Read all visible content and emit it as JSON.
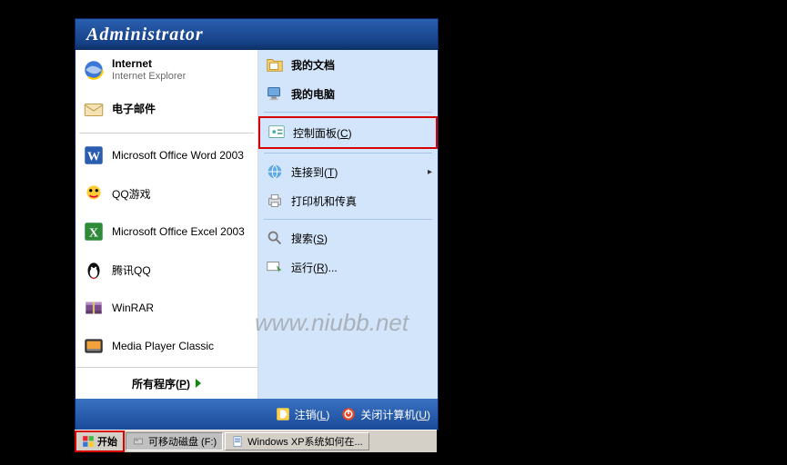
{
  "header": {
    "username": "Administrator"
  },
  "left": {
    "internet": {
      "title": "Internet",
      "subtitle": "Internet Explorer"
    },
    "email": {
      "title": "电子邮件"
    },
    "pinned": [
      {
        "id": "word",
        "label": "Microsoft Office Word 2003"
      },
      {
        "id": "qqgame",
        "label": "QQ游戏"
      },
      {
        "id": "excel",
        "label": "Microsoft Office Excel 2003"
      },
      {
        "id": "qq",
        "label": "腾讯QQ"
      },
      {
        "id": "winrar",
        "label": "WinRAR"
      },
      {
        "id": "mpc",
        "label": "Media Player Classic"
      }
    ],
    "all_programs": {
      "label": "所有程序(",
      "key": "P",
      "suffix": ")"
    }
  },
  "right": {
    "items": [
      {
        "id": "mydocs",
        "label": "我的文档",
        "bold": true
      },
      {
        "id": "mycomp",
        "label": "我的电脑",
        "bold": true
      },
      {
        "sep": true
      },
      {
        "id": "control",
        "label": "控制面板(",
        "key": "C",
        "suffix": ")",
        "highlight": true
      },
      {
        "sep": true
      },
      {
        "id": "connect",
        "label": "连接到(",
        "key": "T",
        "suffix": ")",
        "submenu": true
      },
      {
        "id": "printers",
        "label": "打印机和传真"
      },
      {
        "sep": true
      },
      {
        "id": "search",
        "label": "搜索(",
        "key": "S",
        "suffix": ")"
      },
      {
        "id": "run",
        "label": "运行(",
        "key": "R",
        "suffix": ")..."
      }
    ]
  },
  "footer": {
    "logoff": {
      "label": "注销(",
      "key": "L",
      "suffix": ")"
    },
    "shutdown": {
      "label": "关闭计算机(",
      "key": "U",
      "suffix": ")"
    }
  },
  "taskbar": {
    "start": "开始",
    "buttons": [
      {
        "id": "removable",
        "label": "可移动磁盘 (F:)"
      },
      {
        "id": "doc",
        "label": "Windows XP系统如何在..."
      }
    ]
  },
  "watermark": "www.niubb.net"
}
